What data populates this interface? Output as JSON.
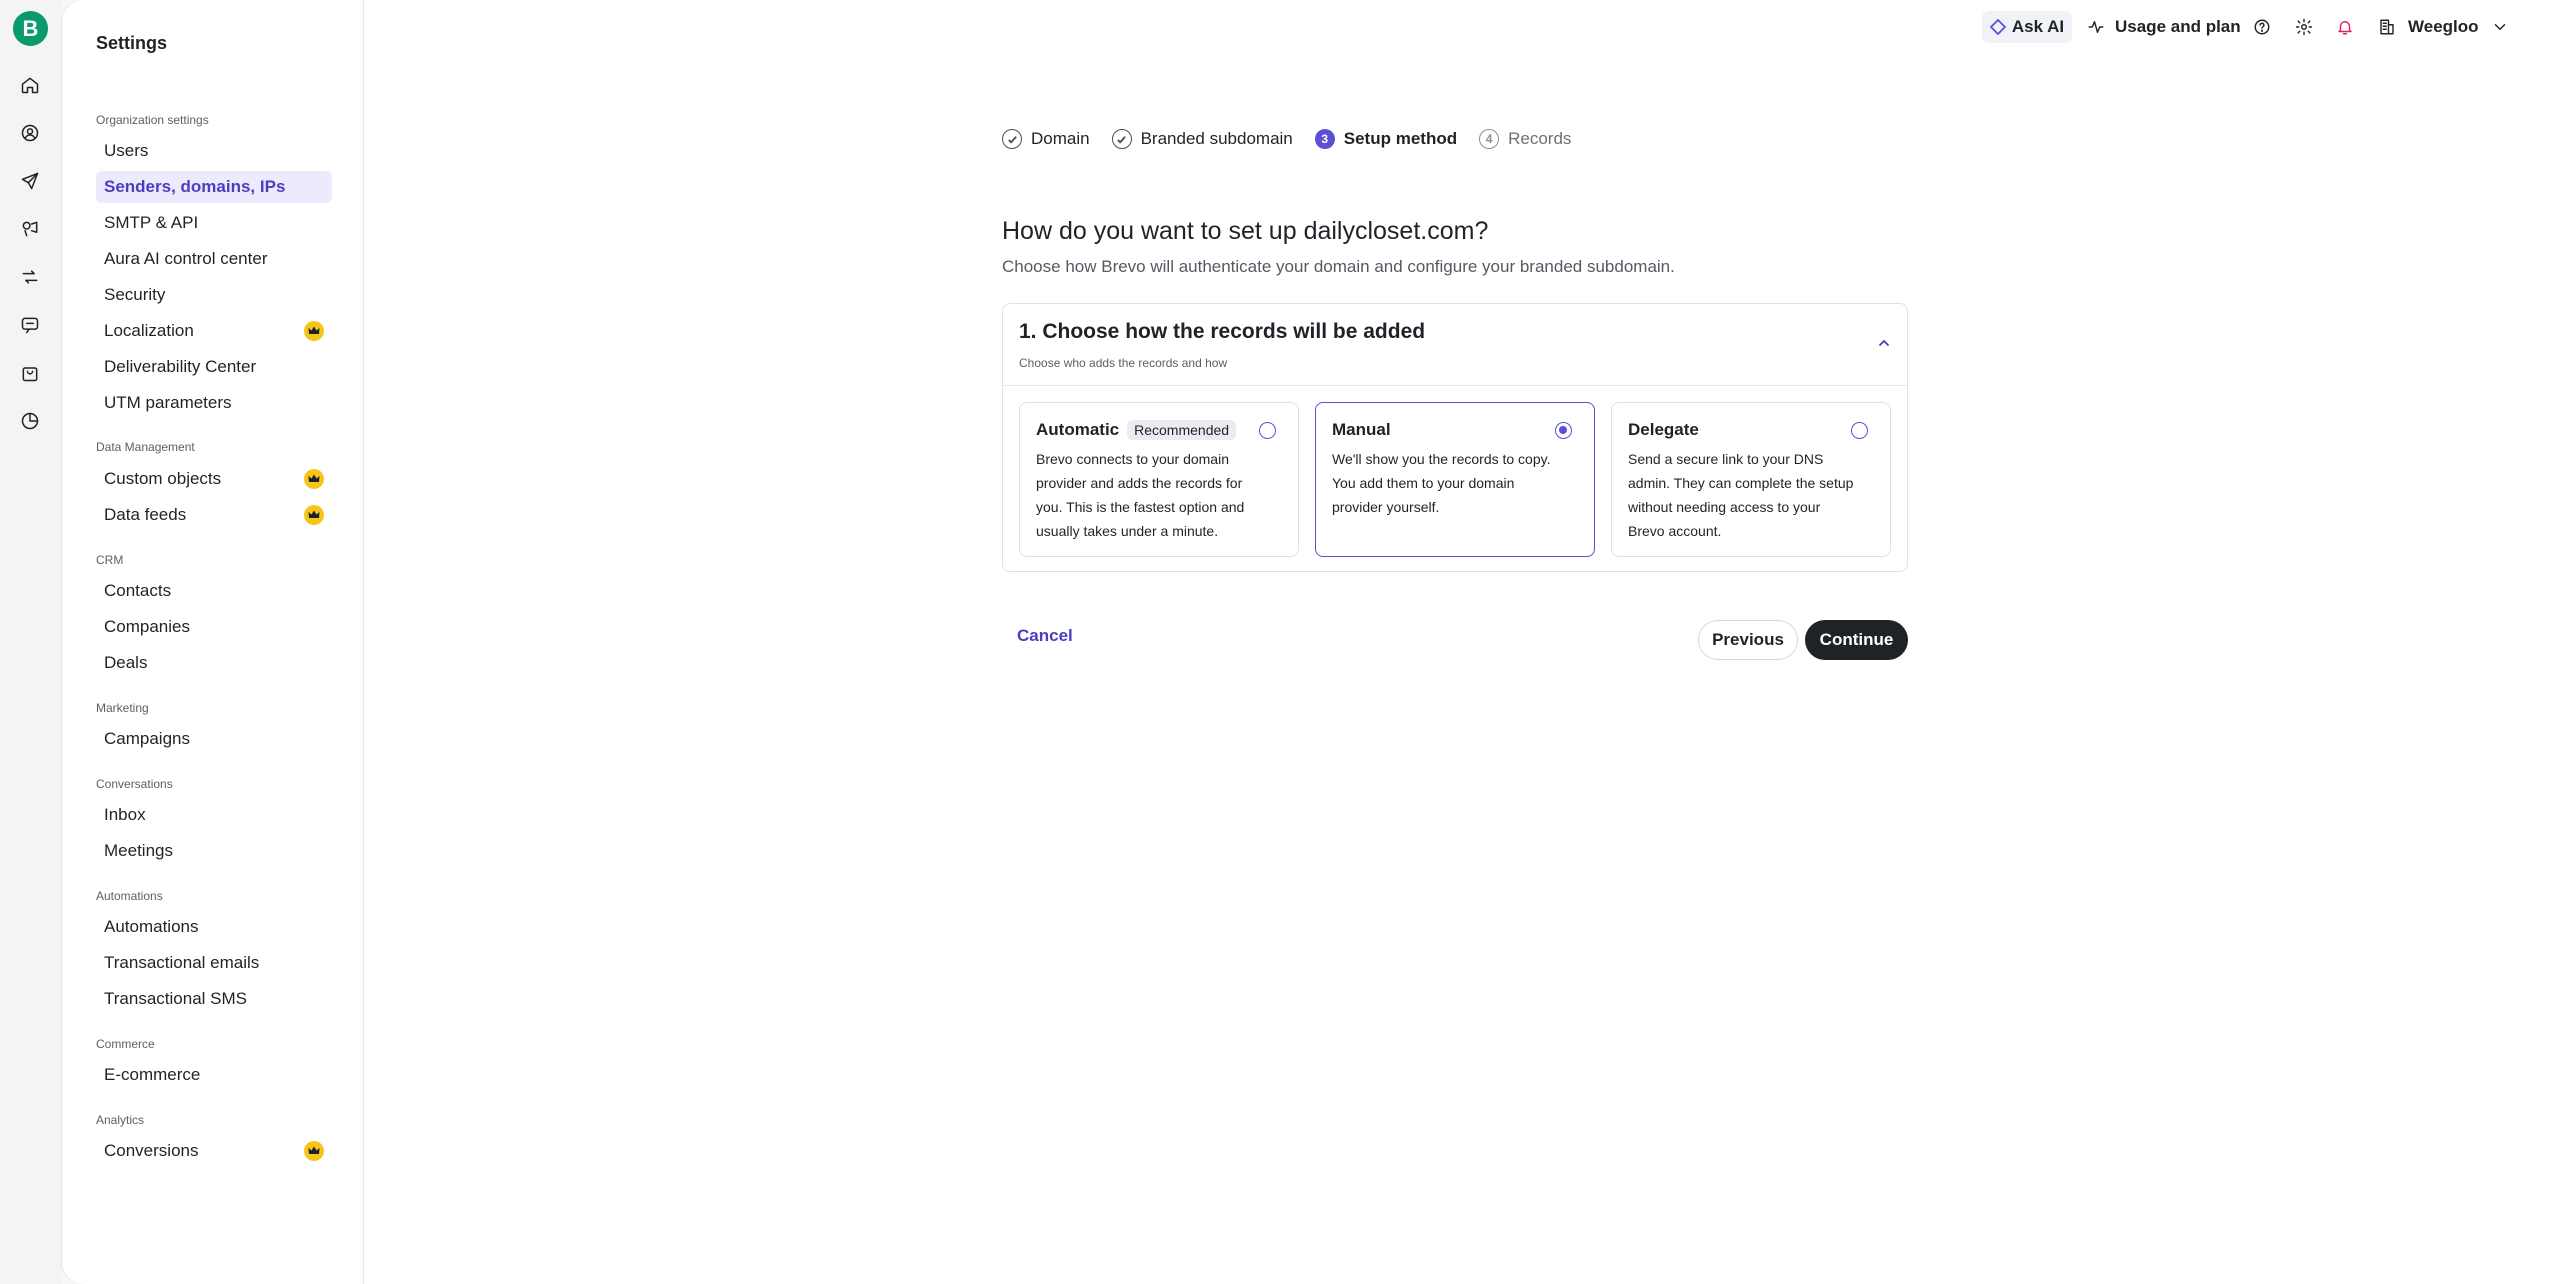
{
  "topbar": {
    "ask_ai": "Ask AI",
    "usage": "Usage and plan",
    "account": "Weegloo"
  },
  "rail": {
    "logo": "B",
    "icons": [
      "home-icon",
      "contacts-icon",
      "send-icon",
      "megaphone-icon",
      "automations-icon",
      "chat-icon",
      "bag-icon",
      "chart-icon"
    ]
  },
  "sidebar": {
    "title": "Settings",
    "sections": {
      "org": "Organization settings",
      "data": "Data Management",
      "crm": "CRM",
      "marketing": "Marketing",
      "conversations": "Conversations",
      "automations": "Automations",
      "commerce": "Commerce",
      "analytics": "Analytics"
    },
    "items": {
      "users": "Users",
      "senders": "Senders, domains, IPs",
      "smtp": "SMTP & API",
      "aura": "Aura AI control center",
      "security": "Security",
      "localization": "Localization",
      "deliverability": "Deliverability Center",
      "utm": "UTM parameters",
      "custom_objects": "Custom objects",
      "data_feeds": "Data feeds",
      "contacts": "Contacts",
      "companies": "Companies",
      "deals": "Deals",
      "campaigns": "Campaigns",
      "inbox": "Inbox",
      "meetings": "Meetings",
      "automations": "Automations",
      "transactional_emails": "Transactional emails",
      "transactional_sms": "Transactional SMS",
      "ecommerce": "E-commerce",
      "conversions": "Conversions"
    }
  },
  "stepper": {
    "steps": [
      {
        "label": "Domain",
        "state": "done"
      },
      {
        "label": "Branded subdomain",
        "state": "done"
      },
      {
        "label": "Setup method",
        "state": "current",
        "number": "3"
      },
      {
        "label": "Records",
        "state": "future",
        "number": "4"
      }
    ]
  },
  "main": {
    "title": "How do you want to set up dailycloset.com?",
    "subtitle": "Choose how Brevo will authenticate your domain and configure your branded subdomain.",
    "panel": {
      "title": "1. Choose how the records will be added",
      "subtitle": "Choose who adds the records and how"
    },
    "options": [
      {
        "title": "Automatic",
        "badge": "Recommended",
        "description": "Brevo connects to your domain provider and adds the records for you. This is the fastest option and usually takes under a minute.",
        "selected": false
      },
      {
        "title": "Manual",
        "description": "We'll show you the records to copy. You add them to your domain provider yourself.",
        "selected": true
      },
      {
        "title": "Delegate",
        "description": "Send a secure link to your DNS admin. They can complete the setup without needing access to your Brevo account.",
        "selected": false
      }
    ],
    "cancel": "Cancel",
    "previous": "Previous",
    "continue": "Continue"
  },
  "colors": {
    "accent": "#5b4fd6",
    "brand": "#0b996e",
    "premium": "#f5c518",
    "dark_button": "#1f2328"
  }
}
